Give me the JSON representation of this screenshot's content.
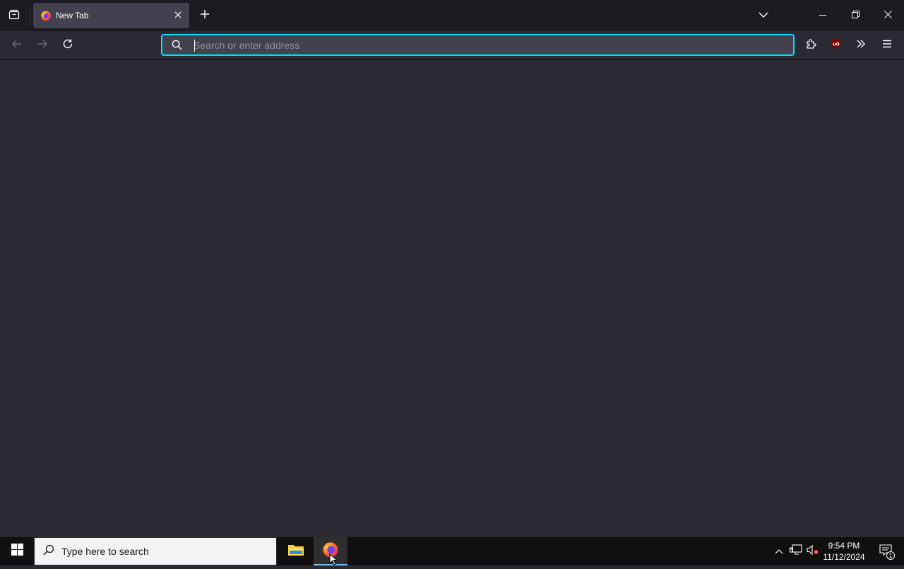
{
  "browser": {
    "tabs": [
      {
        "title": "New Tab",
        "favicon": "firefox-icon",
        "active": true
      }
    ],
    "close_tab_icon": "close-icon",
    "new_tab_icon": "plus-icon",
    "tab_list_icon": "tab-list-icon",
    "list_all_tabs_icon": "chevron-down-icon",
    "window_controls": [
      "minimize-icon",
      "restore-icon",
      "close-icon"
    ]
  },
  "toolbar": {
    "back_icon": "arrow-left-icon",
    "forward_icon": "arrow-right-icon",
    "reload_icon": "reload-icon",
    "urlbar": {
      "value": "",
      "placeholder": "Search or enter address",
      "focus_color": "#00ddff"
    },
    "extensions_icon": "puzzle-icon",
    "ublock_icon": "ublock-origin-icon",
    "overflow_icon": "double-chevron-icon",
    "menu_icon": "hamburger-icon"
  },
  "taskbar": {
    "search_placeholder": "Type here to search",
    "apps": [
      {
        "name": "File Explorer",
        "icon": "folder-icon",
        "active": false
      },
      {
        "name": "Firefox",
        "icon": "firefox-icon",
        "active": true
      }
    ],
    "tray": [
      "chevron-up-icon",
      "network-icon",
      "volume-muted-icon"
    ],
    "clock": {
      "time": "9:54 PM",
      "date": "11/12/2024"
    },
    "notifications": {
      "count": "1"
    }
  },
  "colors": {
    "toolbar_bg": "#2b2a33",
    "tabbar_bg": "#1c1b22",
    "active_tab_bg": "#42414d",
    "taskbar_bg": "#101010",
    "accent": "#00ddff"
  }
}
